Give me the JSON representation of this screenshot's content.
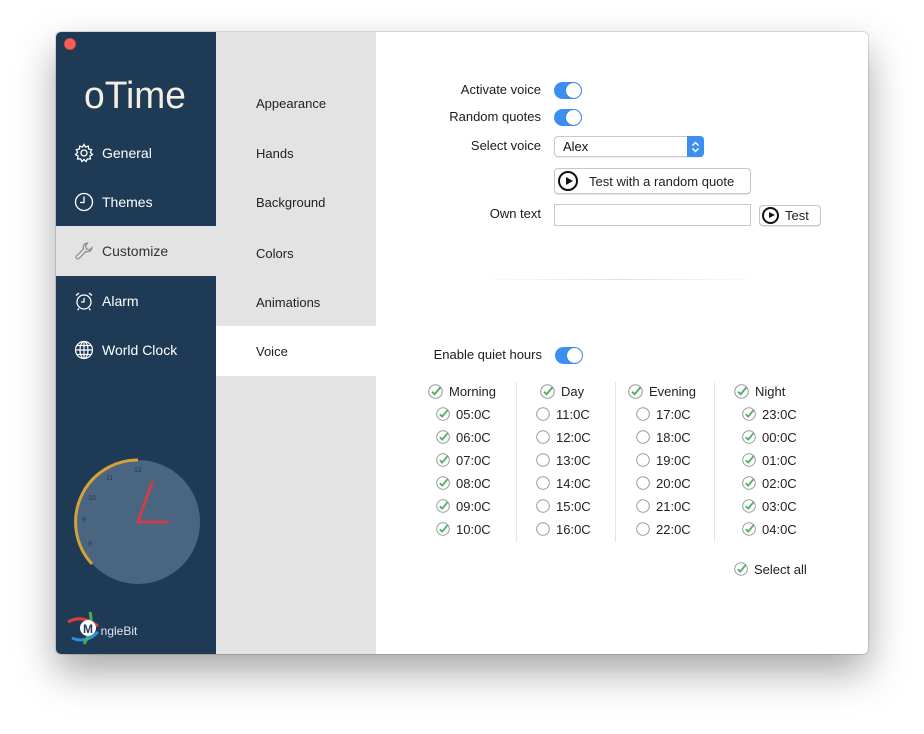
{
  "app": {
    "logo_text": "oTime",
    "brand": "MingleBit"
  },
  "sidebar": {
    "items": [
      {
        "label": "General",
        "icon": "gear-icon",
        "active": false
      },
      {
        "label": "Themes",
        "icon": "clock-icon",
        "active": false
      },
      {
        "label": "Customize",
        "icon": "wrench-icon",
        "active": true
      },
      {
        "label": "Alarm",
        "icon": "alarm-clock-icon",
        "active": false
      },
      {
        "label": "World Clock",
        "icon": "globe-icon",
        "active": false
      }
    ]
  },
  "subnav": {
    "items": [
      {
        "label": "Appearance",
        "active": false
      },
      {
        "label": "Hands",
        "active": false
      },
      {
        "label": "Background",
        "active": false
      },
      {
        "label": "Colors",
        "active": false
      },
      {
        "label": "Animations",
        "active": false
      },
      {
        "label": "Voice",
        "active": true
      }
    ]
  },
  "voice": {
    "activate_label": "Activate voice",
    "activate_on": true,
    "random_quotes_label": "Random quotes",
    "random_quotes_on": true,
    "select_voice_label": "Select voice",
    "selected_voice": "Alex",
    "test_random_label": "Test with a random quote",
    "own_text_label": "Own text",
    "own_text_value": "",
    "test_label": "Test"
  },
  "quiet_hours": {
    "enable_label": "Enable quiet hours",
    "enabled": true,
    "columns": [
      {
        "label": "Morning",
        "checked": true,
        "hours": [
          {
            "time": "05:0C",
            "checked": true
          },
          {
            "time": "06:0C",
            "checked": true
          },
          {
            "time": "07:0C",
            "checked": true
          },
          {
            "time": "08:0C",
            "checked": true
          },
          {
            "time": "09:0C",
            "checked": true
          },
          {
            "time": "10:0C",
            "checked": true
          }
        ]
      },
      {
        "label": "Day",
        "checked": true,
        "hours": [
          {
            "time": "11:0C",
            "checked": false
          },
          {
            "time": "12:0C",
            "checked": false
          },
          {
            "time": "13:0C",
            "checked": false
          },
          {
            "time": "14:0C",
            "checked": false
          },
          {
            "time": "15:0C",
            "checked": false
          },
          {
            "time": "16:0C",
            "checked": false
          }
        ]
      },
      {
        "label": "Evening",
        "checked": true,
        "hours": [
          {
            "time": "17:0C",
            "checked": false
          },
          {
            "time": "18:0C",
            "checked": false
          },
          {
            "time": "19:0C",
            "checked": false
          },
          {
            "time": "20:0C",
            "checked": false
          },
          {
            "time": "21:0C",
            "checked": false
          },
          {
            "time": "22:0C",
            "checked": false
          }
        ]
      },
      {
        "label": "Night",
        "checked": true,
        "hours": [
          {
            "time": "23:0C",
            "checked": true
          },
          {
            "time": "00:0C",
            "checked": true
          },
          {
            "time": "01:0C",
            "checked": true
          },
          {
            "time": "02:0C",
            "checked": true
          },
          {
            "time": "03:0C",
            "checked": true
          },
          {
            "time": "04:0C",
            "checked": true
          }
        ]
      }
    ],
    "select_all_label": "Select all",
    "select_all_checked": true
  },
  "clock": {
    "tick_labels": [
      "12",
      "11",
      "10",
      "9",
      "8"
    ]
  },
  "colors": {
    "sidebar_bg": "#1f3a54",
    "accent": "#3b8ff0",
    "check_green": "#4caf6a",
    "clock_ring": "#d4a13a",
    "clock_hand": "#e2383c"
  }
}
